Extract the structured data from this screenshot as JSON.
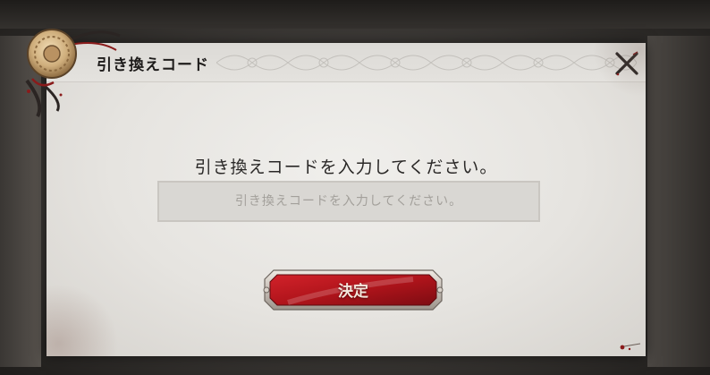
{
  "dialog": {
    "title": "引き換えコード",
    "prompt": "引き換えコードを入力してください。",
    "input_placeholder": "引き換えコードを入力してください。",
    "input_value": "",
    "confirm_label": "決定"
  },
  "icons": {
    "close": "close-x-icon",
    "seal": "wax-seal-emblem"
  },
  "colors": {
    "accent_red": "#b3141c",
    "text_dark": "#2a2827",
    "panel": "#e8e6e2"
  }
}
